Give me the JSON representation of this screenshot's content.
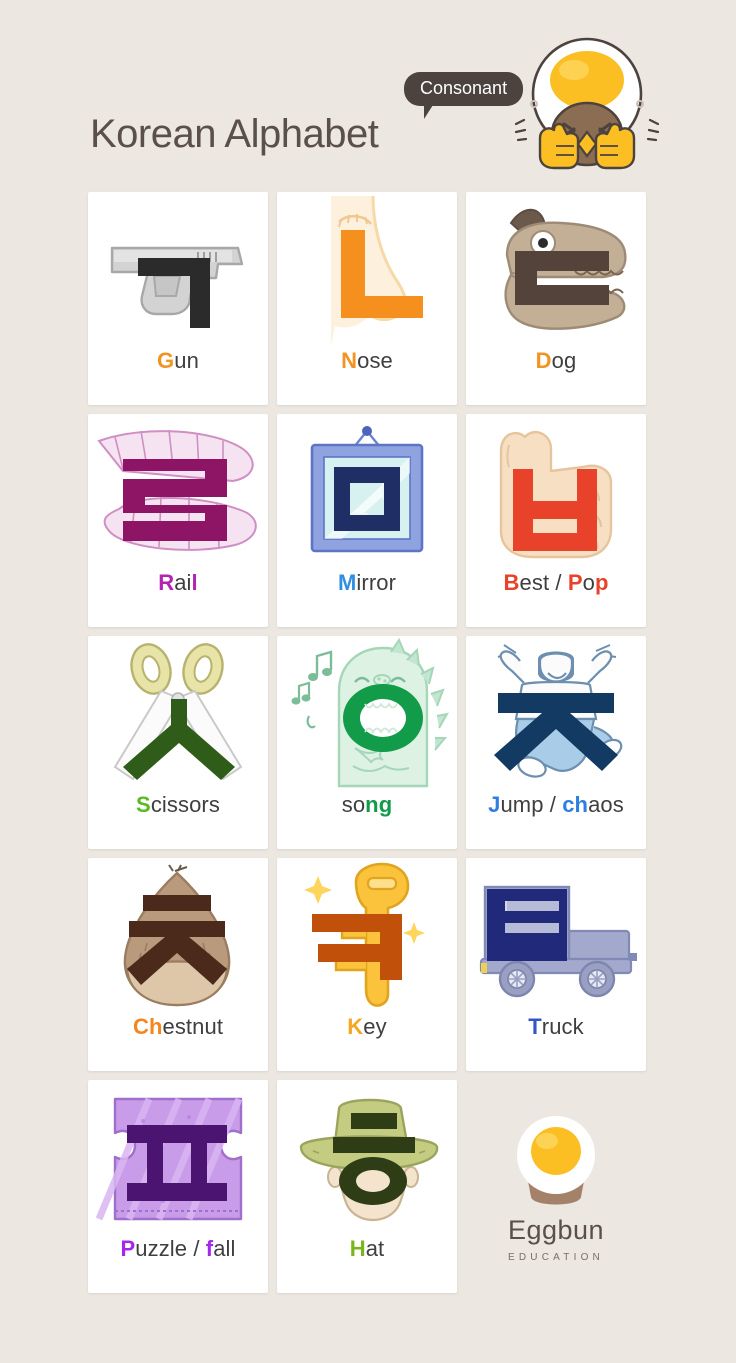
{
  "theme": {
    "background": "#ece7e1",
    "card_background": "#ffffff",
    "title_color": "#5a4f4a",
    "bubble_background": "#4c423e",
    "bubble_text_color": "#ffffff",
    "label_color": "#3f3f3f",
    "accent_orange": "#f29422"
  },
  "header": {
    "title": "Korean Alphabet",
    "badge": "Consonant",
    "mascot_name": "eggbun-mascot"
  },
  "cards": [
    {
      "id": "giyeok",
      "jamo": "ㄱ",
      "jamo_color": "#2b2b2b",
      "label_parts": [
        {
          "text": "G",
          "color": "#f29422"
        },
        {
          "text": "un",
          "color": "#3f3f3f"
        }
      ],
      "label_plain": "Gun",
      "art": "pistol"
    },
    {
      "id": "nieun",
      "jamo": "ㄴ",
      "jamo_color": "#f5901e",
      "label_parts": [
        {
          "text": "N",
          "color": "#f29422"
        },
        {
          "text": "ose",
          "color": "#3f3f3f"
        }
      ],
      "label_plain": "Nose",
      "art": "nose"
    },
    {
      "id": "digeut",
      "jamo": "ㄷ",
      "jamo_color": "#54433a",
      "label_parts": [
        {
          "text": "D",
          "color": "#f29422"
        },
        {
          "text": "og",
          "color": "#3f3f3f"
        }
      ],
      "label_plain": "Dog",
      "art": "dog"
    },
    {
      "id": "rieul",
      "jamo": "ㄹ",
      "jamo_color": "#8e1466",
      "label_parts": [
        {
          "text": "R",
          "color": "#b324b3"
        },
        {
          "text": "ai",
          "color": "#3f3f3f"
        },
        {
          "text": "l",
          "color": "#b324b3"
        }
      ],
      "label_plain": "Rail",
      "art": "rail"
    },
    {
      "id": "mieum",
      "jamo": "ㅁ",
      "jamo_color": "#1f2f66",
      "label_parts": [
        {
          "text": "M",
          "color": "#2f8fe0"
        },
        {
          "text": "irror",
          "color": "#3f3f3f"
        }
      ],
      "label_plain": "Mirror",
      "art": "mirror"
    },
    {
      "id": "bieup",
      "jamo": "ㅂ",
      "jamo_color": "#e8422a",
      "label_parts": [
        {
          "text": "B",
          "color": "#e8422a"
        },
        {
          "text": "est / ",
          "color": "#3f3f3f"
        },
        {
          "text": "P",
          "color": "#e8422a"
        },
        {
          "text": "o",
          "color": "#3f3f3f"
        },
        {
          "text": "p",
          "color": "#e8422a"
        }
      ],
      "label_plain": "Best / Pop",
      "art": "thumbs-up"
    },
    {
      "id": "siot",
      "jamo": "ㅅ",
      "jamo_color": "#2f5c18",
      "label_parts": [
        {
          "text": "S",
          "color": "#5aba21"
        },
        {
          "text": "cissors",
          "color": "#3f3f3f"
        }
      ],
      "label_plain": "Scissors",
      "art": "scissors"
    },
    {
      "id": "ieung",
      "jamo": "ㅇ",
      "jamo_color": "#129c4a",
      "label_parts": [
        {
          "text": "so",
          "color": "#3f3f3f"
        },
        {
          "text": "ng",
          "color": "#129c4a"
        }
      ],
      "label_plain": "song",
      "art": "singing-dino"
    },
    {
      "id": "jieut",
      "jamo": "ㅈ",
      "jamo_color": "#123a63",
      "label_parts": [
        {
          "text": "J",
          "color": "#2f7fe0"
        },
        {
          "text": "ump / ",
          "color": "#3f3f3f"
        },
        {
          "text": "ch",
          "color": "#2f7fe0"
        },
        {
          "text": "aos",
          "color": "#3f3f3f"
        }
      ],
      "label_plain": "Jump / chaos",
      "art": "jumping-person"
    },
    {
      "id": "chieut",
      "jamo": "ㅊ",
      "jamo_color": "#4b2a1c",
      "label_parts": [
        {
          "text": "Ch",
          "color": "#f5861f"
        },
        {
          "text": "estnut",
          "color": "#3f3f3f"
        }
      ],
      "label_plain": "Chestnut",
      "art": "chestnut"
    },
    {
      "id": "kieuk",
      "jamo": "ㅋ",
      "jamo_color": "#c1500b",
      "label_parts": [
        {
          "text": "K",
          "color": "#f5a623"
        },
        {
          "text": "ey",
          "color": "#3f3f3f"
        }
      ],
      "label_plain": "Key",
      "art": "key"
    },
    {
      "id": "tieut",
      "jamo": "ㅌ",
      "jamo_color": "#212a7a",
      "label_parts": [
        {
          "text": "T",
          "color": "#3355cc"
        },
        {
          "text": "ruck",
          "color": "#3f3f3f"
        }
      ],
      "label_plain": "Truck",
      "art": "truck"
    },
    {
      "id": "pieup",
      "jamo": "ㅍ",
      "jamo_color": "#4b1470",
      "label_parts": [
        {
          "text": "P",
          "color": "#a626f0"
        },
        {
          "text": "uzzle / ",
          "color": "#3f3f3f"
        },
        {
          "text": "f",
          "color": "#a626f0"
        },
        {
          "text": "all",
          "color": "#3f3f3f"
        }
      ],
      "label_plain": "Puzzle / fall",
      "art": "puzzle"
    },
    {
      "id": "hieut",
      "jamo": "ㅎ",
      "jamo_color": "#2e3d16",
      "label_parts": [
        {
          "text": "H",
          "color": "#7ab51d"
        },
        {
          "text": "at",
          "color": "#3f3f3f"
        }
      ],
      "label_plain": "Hat",
      "art": "hat"
    }
  ],
  "logo": {
    "word": "Eggbun",
    "subtitle": "EDUCATION",
    "icon": "egg-on-bun"
  }
}
